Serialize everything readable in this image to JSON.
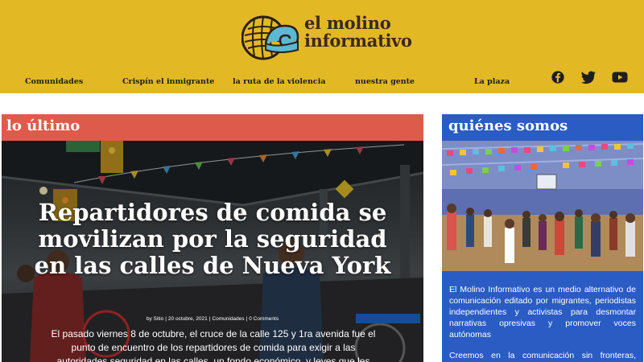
{
  "brand": {
    "name_line1": "el molino",
    "name_line2": "informativo",
    "logo_icon": "wheel-wave-logo",
    "colors": {
      "header": "#e3b825",
      "accent_red": "#de5b4b",
      "accent_blue": "#2a5cc3"
    }
  },
  "nav": {
    "items": [
      {
        "label": "Comunidades"
      },
      {
        "label": "Crispín el inmigrante"
      },
      {
        "label": "la ruta de la violencia"
      },
      {
        "label": "nuestra gente"
      },
      {
        "label": "La plaza"
      }
    ],
    "social": [
      "facebook-icon",
      "twitter-icon",
      "youtube-icon"
    ]
  },
  "latest": {
    "title": "lo último",
    "post": {
      "headline": "Repartidores de comida se movilizan por la seguridad en las calles de Nueva York",
      "author": "by Sitio",
      "date": "20 octubre, 2021",
      "category": "Comunidades",
      "comments": "0 Comments",
      "excerpt": "El pasado viernes 8 de octubre, el cruce de la calle 125 y 1ra avenida fue el punto de encuentro de los repartidores de comida para exigir a las autoridades seguridad en las calles,  un fondo económico, y leyes que les"
    }
  },
  "about": {
    "title": "quiénes somos",
    "paragraph1": "El Molino Informativo es un medio alternativo de comunicación editado por migrantes, periodistas independientes y activistas para desmontar narrativas opresivas y promover voces autónomas",
    "paragraph2": "Creemos en la comunicación sin fronteras, popular y latinoamericanista."
  }
}
